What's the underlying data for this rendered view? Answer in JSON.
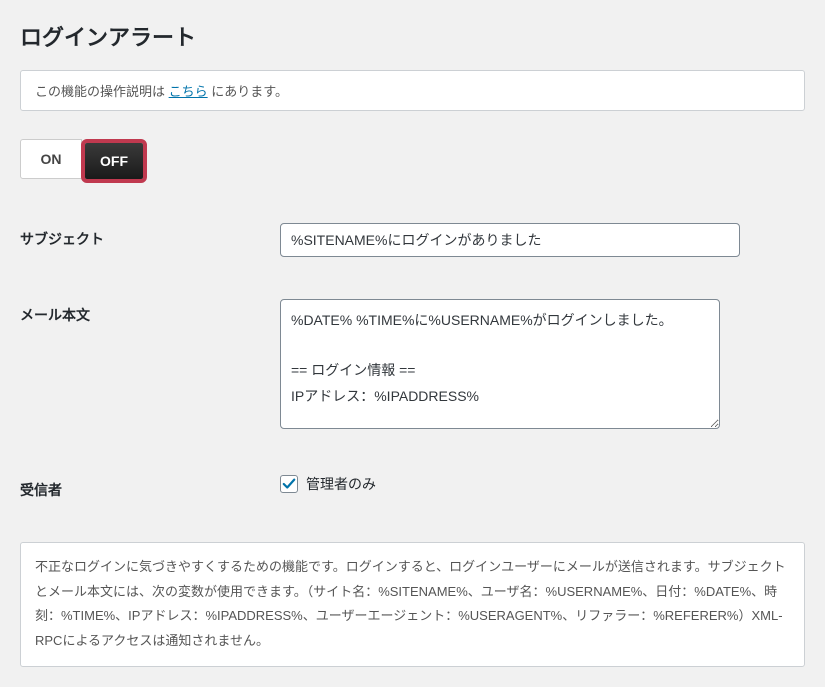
{
  "title": "ログインアラート",
  "info": {
    "prefix": "この機能の操作説明は ",
    "link": "こちら",
    "suffix": " にあります。"
  },
  "toggle": {
    "on": "ON",
    "off": "OFF",
    "active": "off"
  },
  "fields": {
    "subject": {
      "label": "サブジェクト",
      "value": "%SITENAME%にログインがありました"
    },
    "body": {
      "label": "メール本文",
      "value": "%DATE% %TIME%に%USERNAME%がログインしました。\n\n== ログイン情報 ==\nIPアドレス：%IPADDRESS%"
    },
    "recipient": {
      "label": "受信者",
      "checkbox_label": "管理者のみ",
      "checked": true
    }
  },
  "description": "不正なログインに気づきやすくするための機能です。ログインすると、ログインユーザーにメールが送信されます。サブジェクトとメール本文には、次の変数が使用できます。（サイト名：%SITENAME%、ユーザ名：%USERNAME%、日付：%DATE%、時刻：%TIME%、IPアドレス：%IPADDRESS%、ユーザーエージェント：%USERAGENT%、リファラー：%REFERER%）XML-RPCによるアクセスは通知されません。"
}
